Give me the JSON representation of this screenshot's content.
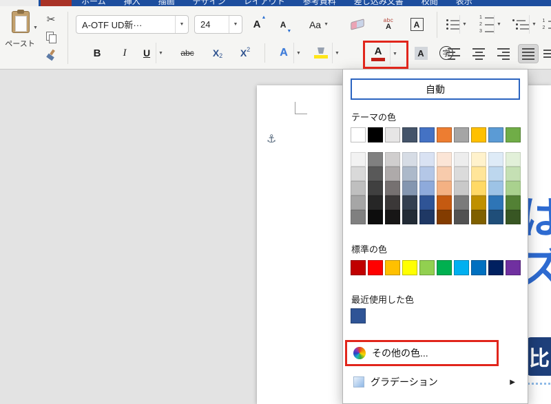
{
  "titlebar": {
    "tabs": [
      "ホーム",
      "挿入",
      "描画",
      "デザイン",
      "レイアウト",
      "参考資料",
      "差し込み文書",
      "校閲",
      "表示"
    ]
  },
  "icons": {
    "caret_down": "▼",
    "caret_up": "▲",
    "caret_right": "▶",
    "scissors": "✂",
    "anchor": "⚓"
  },
  "ribbon": {
    "paste_label": "ペースト",
    "font_name": "A-OTF UD新···",
    "font_size": "24",
    "grow_label": "A",
    "shrink_label": "A",
    "case_label": "Aa",
    "ruby_top": "abc",
    "ruby_base": "A",
    "border_a_label": "A",
    "bold_label": "B",
    "italic_label": "I",
    "underline_label": "U",
    "strike_label": "abc",
    "subscript_base": "X",
    "subscript_mark": "2",
    "superscript_base": "X",
    "superscript_mark": "2",
    "effects_label": "A",
    "font_color_label": "A",
    "shading_label": "A",
    "enclose_label": "字",
    "font_color_current": "#c11f17",
    "highlight_current": "#ffe61a"
  },
  "color_menu": {
    "automatic": "自動",
    "theme_title": "テーマの色",
    "standard_title": "標準の色",
    "recent_title": "最近使用した色",
    "more_colors": "その他の色...",
    "gradient": "グラデーション",
    "accent_border": "#2a63c0",
    "theme_colors": [
      "#FFFFFF",
      "#000000",
      "#E7E6E6",
      "#44546A",
      "#4472C4",
      "#ED7D31",
      "#A5A5A5",
      "#FFC000",
      "#5B9BD5",
      "#70AD47"
    ],
    "theme_variants": [
      [
        "#F2F2F2",
        "#808080",
        "#D0CECE",
        "#D6DCE5",
        "#D9E2F3",
        "#FBE5D6",
        "#EDEDED",
        "#FFF2CC",
        "#DEEBF7",
        "#E2F0D9"
      ],
      [
        "#D9D9D9",
        "#595959",
        "#AEAAAA",
        "#ACB9CA",
        "#B4C7E7",
        "#F7CBAC",
        "#DBDBDB",
        "#FFE599",
        "#BDD7EE",
        "#C5E0B4"
      ],
      [
        "#BFBFBF",
        "#404040",
        "#767171",
        "#8496B0",
        "#8EAADB",
        "#F4B183",
        "#C9C9C9",
        "#FFD966",
        "#9DC3E6",
        "#A9D18E"
      ],
      [
        "#A6A6A6",
        "#262626",
        "#3B3838",
        "#333F50",
        "#2F5496",
        "#C55A11",
        "#7B7B7B",
        "#BF9000",
        "#2E75B6",
        "#538135"
      ],
      [
        "#808080",
        "#0D0D0D",
        "#171616",
        "#222B35",
        "#1F3864",
        "#833C00",
        "#525252",
        "#7F6000",
        "#1F4E79",
        "#385623"
      ]
    ],
    "standard_colors": [
      "#C00000",
      "#FF0000",
      "#FFC000",
      "#FFFF00",
      "#92D050",
      "#00B050",
      "#00B0F0",
      "#0070C0",
      "#002060",
      "#7030A0"
    ],
    "recent_colors": [
      "#2F5496"
    ]
  },
  "document": {
    "fragment_1": "ぱ",
    "fragment_2": "ズ",
    "badge_char": "比"
  },
  "annotations": {
    "box_color": "#e1251b"
  }
}
